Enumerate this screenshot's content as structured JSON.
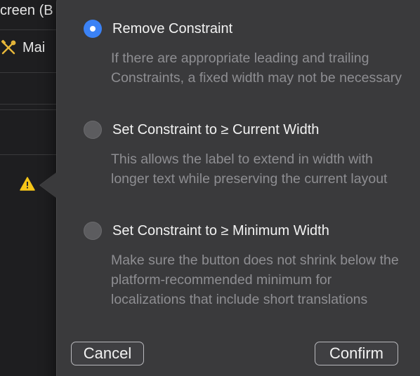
{
  "background": {
    "title": "creen (B",
    "row_label": "Mai",
    "row_icon": "hammer-wrench-icon",
    "warning_icon": "warning-triangle-icon"
  },
  "popover": {
    "options": [
      {
        "label": "Remove Constraint",
        "description": "If there are appropriate leading and trailing Constraints, a fixed width may not be necessary",
        "selected": true
      },
      {
        "label": "Set Constraint to ≥ Current Width",
        "description": "This allows the label to extend in width with longer text while preserving the current layout",
        "selected": false
      },
      {
        "label": "Set Constraint to ≥ Minimum Width",
        "description": "Make sure the button does not shrink below the platform-recommended minimum for localizations that include short translations",
        "selected": false
      }
    ],
    "cancel_label": "Cancel",
    "confirm_label": "Confirm"
  },
  "colors": {
    "accent": "#3b82f6",
    "warning": "#f5c518",
    "popover_bg": "#3a3a3c"
  }
}
